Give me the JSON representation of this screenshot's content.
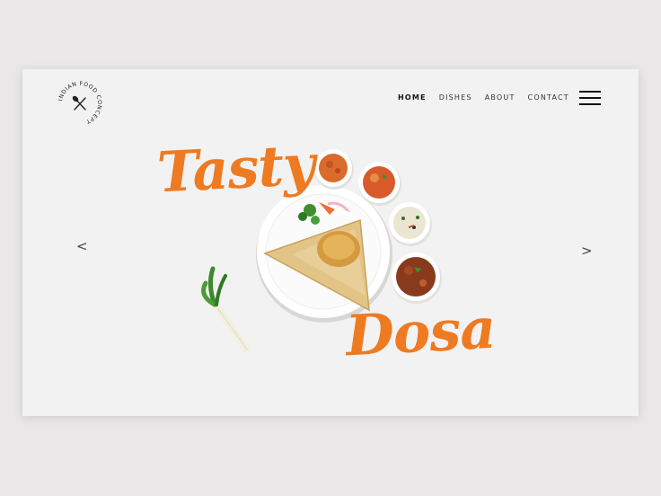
{
  "brand": {
    "logo_text": "INDIAN FOOD CONCEPT"
  },
  "nav": {
    "items": [
      {
        "label": "HOME",
        "active": true
      },
      {
        "label": "DISHES",
        "active": false
      },
      {
        "label": "ABOUT",
        "active": false
      },
      {
        "label": "CONTACT",
        "active": false
      }
    ]
  },
  "hero": {
    "title_line1": "Tasty",
    "title_line2": "Dosa",
    "prev_arrow": "<",
    "next_arrow": ">"
  },
  "colors": {
    "accent": "#ee7a22",
    "page_bg": "#e9e7e8",
    "card_bg": "#f2f2f2"
  },
  "icons": [
    "hamburger-menu-icon",
    "fork-spoon-icon"
  ]
}
